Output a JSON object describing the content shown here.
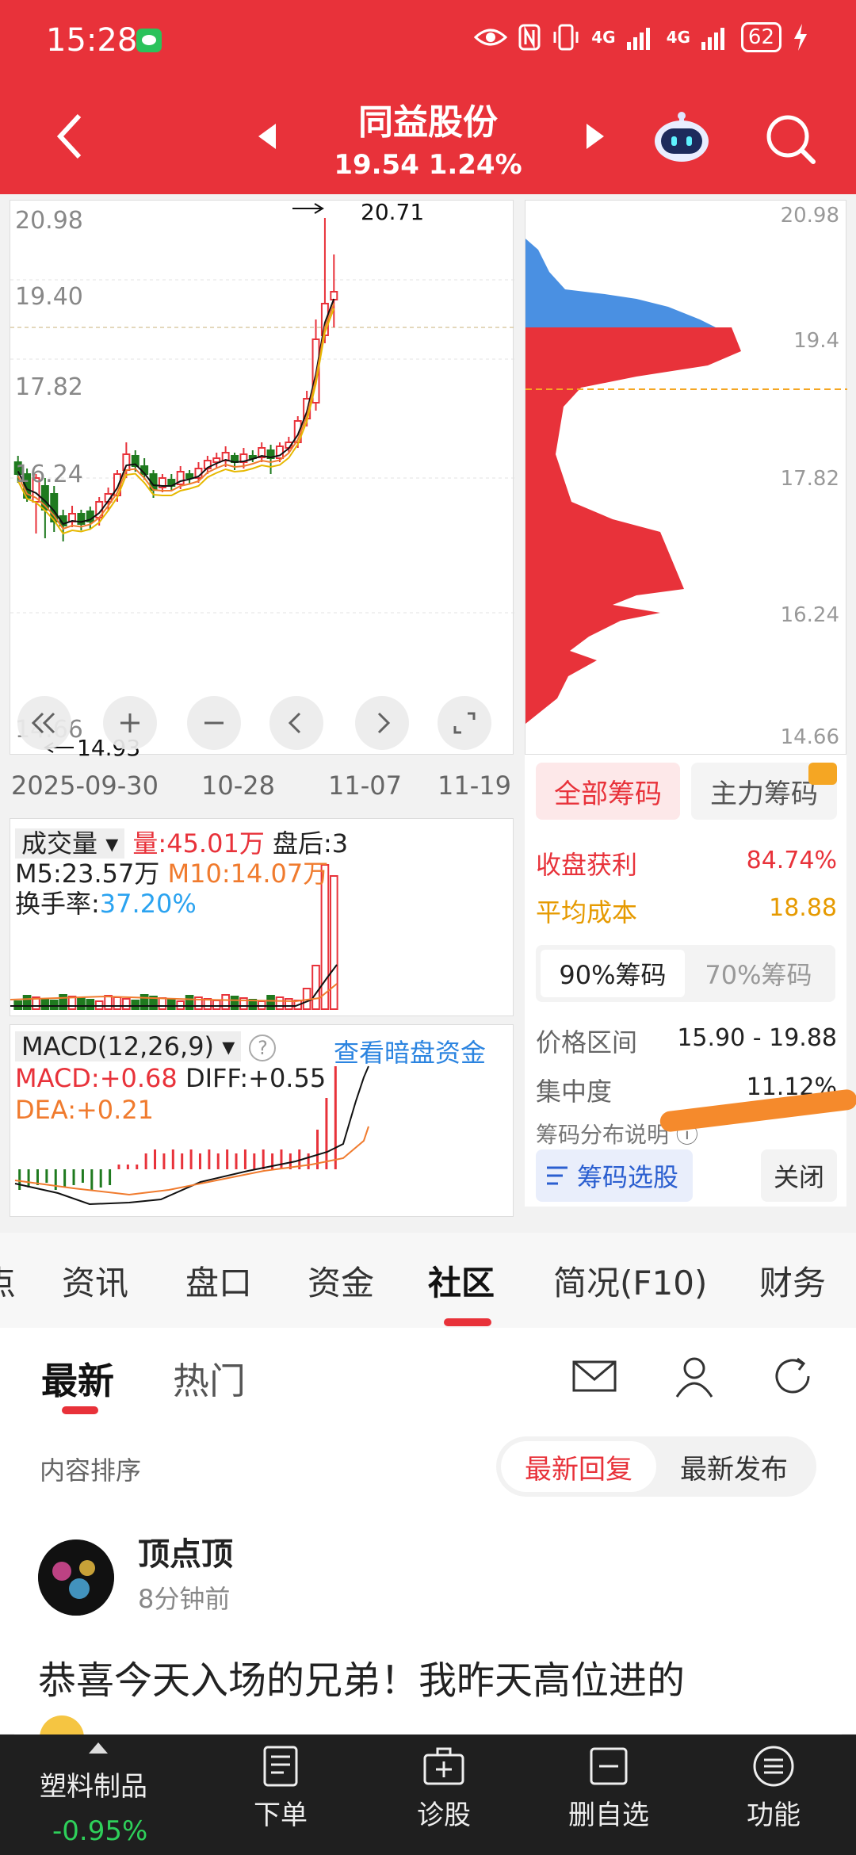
{
  "status_bar": {
    "time": "15:28",
    "battery": "62",
    "net1": "4G",
    "net2": "4G"
  },
  "header": {
    "title": "同益股份",
    "price": "19.54",
    "change_pct": "1.24%"
  },
  "kline": {
    "y_labels": [
      "20.98",
      "19.40",
      "17.82",
      "16.24",
      "14.66"
    ],
    "high_label": "20.71",
    "low_label": "14.93",
    "dates": [
      "2025-09-30",
      "10-28",
      "11-07",
      "11-19"
    ]
  },
  "chip_chart": {
    "y_labels": [
      "20.98",
      "19.4",
      "17.82",
      "16.24",
      "14.66"
    ]
  },
  "volume": {
    "selector": "成交量",
    "vol_label": "量:45.01万",
    "after_hours": "盘后:3",
    "m5": "M5:23.57万",
    "m10": "M10:14.07万",
    "turnover_label": "换手率:",
    "turnover_value": "37.20%"
  },
  "macd": {
    "selector": "MACD(12,26,9)",
    "help": "?",
    "dark_pool_link": "查看暗盘资金",
    "macd": "MACD:+0.68",
    "diff": "DIFF:+0.55",
    "dea": "DEA:+0.21"
  },
  "chip_info": {
    "tab_all": "全部筹码",
    "tab_main": "主力筹码",
    "profit_label": "收盘获利",
    "profit_value": "84.74%",
    "avg_cost_label": "平均成本",
    "avg_cost_value": "18.88",
    "opt_90": "90%筹码",
    "opt_70": "70%筹码",
    "range_label": "价格区间",
    "range_value": "15.90 - 19.88",
    "concentration_label": "集中度",
    "concentration_value": "11.12%",
    "explain_label": "筹码分布说明 ⓘ",
    "select_button": "筹码选股",
    "close_button": "关闭"
  },
  "main_tabs": [
    "点",
    "资讯",
    "盘口",
    "资金",
    "社区",
    "简况(F10)",
    "财务"
  ],
  "community": {
    "tab_latest": "最新",
    "tab_hot": "热门",
    "sort_label": "内容排序",
    "sort_reply": "最新回复",
    "sort_publish": "最新发布"
  },
  "post": {
    "author": "顶点顶",
    "time": "8分钟前",
    "text": "恭喜今天入场的兄弟！我昨天高位进的"
  },
  "bottom_bar": {
    "sector_name": "塑料制品",
    "sector_change": "-0.95%",
    "order": "下单",
    "diagnose": "诊股",
    "remove_watch": "删自选",
    "functions": "功能"
  },
  "colors": {
    "brand_red": "#e8323a",
    "down_green": "#1f7a1f",
    "chip_blue": "#4a90e2",
    "bottom_bar": "#1f1f1f"
  }
}
